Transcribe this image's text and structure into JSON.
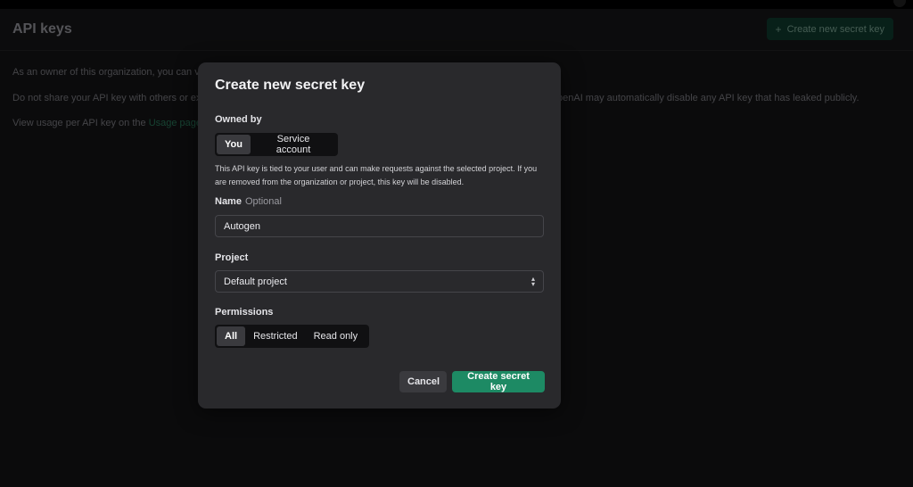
{
  "header": {
    "title": "API keys",
    "create_button_label": "Create new secret key"
  },
  "background_text": {
    "line1": "As an owner of this organization, you can vi",
    "line2_start": "Do not share your API key with others or ex",
    "line2_end": "penAI may automatically disable any API key that has leaked publicly.",
    "line3_prefix": "View usage per API key on the ",
    "line3_link": "Usage page."
  },
  "modal": {
    "title": "Create new secret key",
    "owned_by": {
      "label": "Owned by",
      "options": [
        "You",
        "Service account"
      ],
      "selected": "You"
    },
    "helper_text": "This API key is tied to your user and can make requests against the selected project. If you are removed from the organization or project, this key will be disabled.",
    "name": {
      "label": "Name",
      "optional_label": "Optional",
      "value": "Autogen"
    },
    "project": {
      "label": "Project",
      "value": "Default project"
    },
    "permissions": {
      "label": "Permissions",
      "options": [
        "All",
        "Restricted",
        "Read only"
      ],
      "selected": "All"
    },
    "cancel_label": "Cancel",
    "create_label": "Create secret key"
  },
  "colors": {
    "accent_green": "#1d8a64",
    "modal_bg": "#29292c",
    "page_bg": "#141416"
  },
  "icons": {
    "create_button_icon": "plus-icon",
    "select_icon": "select-arrows-icon"
  }
}
